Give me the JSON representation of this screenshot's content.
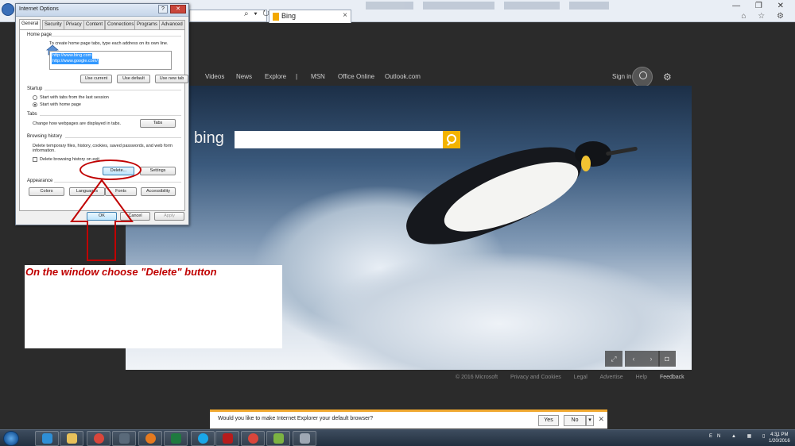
{
  "browser": {
    "tab_title": "Bing",
    "tab_close": "×",
    "address_icons": "⌕ ▾ ↻",
    "window_controls": "— ❐ ✕",
    "tool_icons": "⌂ ☆ ⚙"
  },
  "bing": {
    "logo": "bing",
    "nav": [
      "Videos",
      "News",
      "Explore",
      "|",
      "MSN",
      "Office Online",
      "Outlook.com"
    ],
    "signin": "Sign in",
    "gear": "⚙",
    "image_controls": [
      "⤢",
      "‹",
      "›",
      "◘"
    ],
    "footer": [
      "© 2016 Microsoft",
      "Privacy and Cookies",
      "Legal",
      "Advertise",
      "Help",
      "Feedback"
    ]
  },
  "dialog": {
    "title": "Internet Options",
    "help_btn": "?",
    "close_btn": "✕",
    "tabs": [
      "General",
      "Security",
      "Privacy",
      "Content",
      "Connections",
      "Programs",
      "Advanced"
    ],
    "home_page": {
      "label": "Home page",
      "desc": "To create home page tabs, type each address on its own line.",
      "urls": [
        "http://www.bing.com",
        "http://www.google.com/"
      ],
      "buttons": [
        "Use current",
        "Use default",
        "Use new tab"
      ]
    },
    "startup": {
      "label": "Startup",
      "options": [
        "Start with tabs from the last session",
        "Start with home page"
      ]
    },
    "tabs_group": {
      "label": "Tabs",
      "desc": "Change how webpages are displayed in tabs.",
      "button": "Tabs"
    },
    "browsing_history": {
      "label": "Browsing history",
      "desc": "Delete temporary files, history, cookies, saved passwords, and web form information.",
      "checkbox": "Delete browsing history on exit",
      "delete_button": "Delete...",
      "settings_button": "Settings"
    },
    "appearance": {
      "label": "Appearance",
      "buttons": [
        "Colors",
        "Languages",
        "Fonts",
        "Accessibility"
      ]
    },
    "footer_buttons": [
      "OK",
      "Cancel",
      "Apply"
    ]
  },
  "annotation": {
    "text": "On the window choose \"Delete\" button"
  },
  "notification": {
    "question": "Would you like to make Internet Explorer your default browser?",
    "yes": "Yes",
    "no": "No",
    "dropdown": "▾",
    "close": "✕"
  },
  "taskbar": {
    "tray": "EN ▲ ▦ ▯ ♪",
    "time": "4:31 PM",
    "date": "1/20/2016"
  }
}
